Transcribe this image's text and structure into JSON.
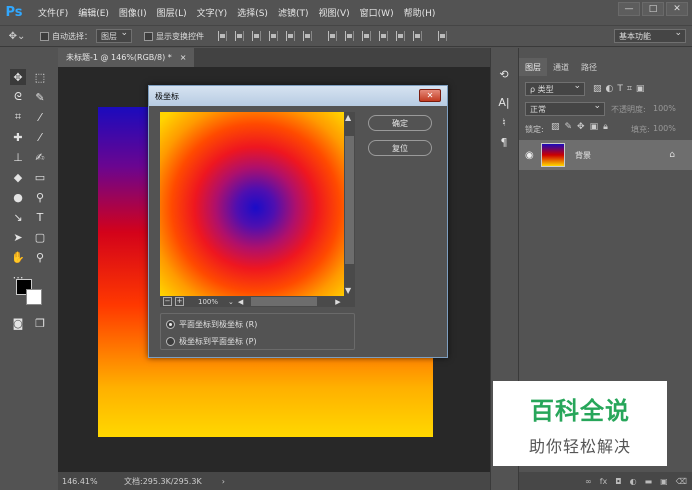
{
  "app": {
    "logo": "Ps"
  },
  "menu": [
    "文件(F)",
    "编辑(E)",
    "图像(I)",
    "图层(L)",
    "文字(Y)",
    "选择(S)",
    "滤镜(T)",
    "视图(V)",
    "窗口(W)",
    "帮助(H)"
  ],
  "window_controls": [
    "—",
    "□",
    "✕"
  ],
  "options": {
    "auto_select_label": "自动选择：",
    "auto_select_value": "图层",
    "show_transform_label": "显示变换控件",
    "workspace": "基本功能"
  },
  "document": {
    "tab_title": "未标题-1 @ 146%(RGB/8) *",
    "tab_close": "×"
  },
  "status": {
    "zoom": "146.41%",
    "doc_info": "文档:295.3K/295.3K",
    "arrow": "›"
  },
  "layers_panel": {
    "tabs": [
      "图层",
      "通道",
      "路径"
    ],
    "filter_placeholder": "ρ 类型",
    "blend_mode": "正常",
    "opacity_label": "不透明度:",
    "opacity_value": "100%",
    "lock_label": "锁定:",
    "fill_label": "填充:",
    "fill_value": "100%",
    "layer_name": "背景"
  },
  "dialog": {
    "title": "极坐标",
    "close": "✕",
    "ok": "确定",
    "reset": "复位",
    "zoom_level": "100%",
    "options": [
      {
        "label": "平面坐标到极坐标 (R)",
        "checked": true
      },
      {
        "label": "极坐标到平面坐标 (P)",
        "checked": false
      }
    ]
  },
  "watermark": {
    "title": "百科全说",
    "subtitle": "助你轻松解决"
  }
}
